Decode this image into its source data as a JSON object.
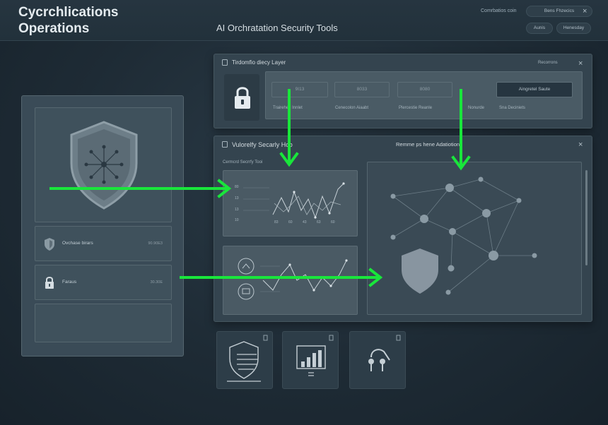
{
  "header": {
    "app_title_line1": "Cycrchlications",
    "app_title_line2": "Operations",
    "page_title": "AI Orchratation Security Tools",
    "top_label": "Comrbatios coin",
    "pill_1": "Bens Fhzecics",
    "pill_2": "Aunis",
    "pill_3": "Henesday",
    "close_icon": "×"
  },
  "identity_panel": {
    "title": "Tirdomfio diecy Layer",
    "recent_label": "Recorrons",
    "fields": [
      "9I13",
      "8033",
      "8080",
      "Aingretel Saute"
    ],
    "captions": [
      "Trairehed Innlet",
      "Cenecolon Aiaabt",
      "Plercestie Reanle",
      "Nonurde",
      "Sna Deciniets"
    ]
  },
  "vuln_panel": {
    "title": "Vulorelfy Secarly Hco",
    "right_title": "Remme ps  hene Adatiotion",
    "sub_label": "Cermcrd Secrrfy Tooi",
    "chart_y_labels": [
      "80",
      "13",
      "13",
      "10"
    ],
    "chart_x_labels": [
      "83",
      "60",
      "43",
      "63",
      "60"
    ]
  },
  "left_panel": {
    "row1_label": "Ovchase birars",
    "row1_value": "90.90E3",
    "row2_label": "Faraus",
    "row2_value": "30.30E"
  },
  "colors": {
    "accent_green": "#19e63b",
    "panel": "#34444f",
    "background": "#1e2b35"
  },
  "icons": [
    "shield-network-icon",
    "lock-icon",
    "shield-icon",
    "chart-icon",
    "network-icon",
    "close-icon"
  ]
}
